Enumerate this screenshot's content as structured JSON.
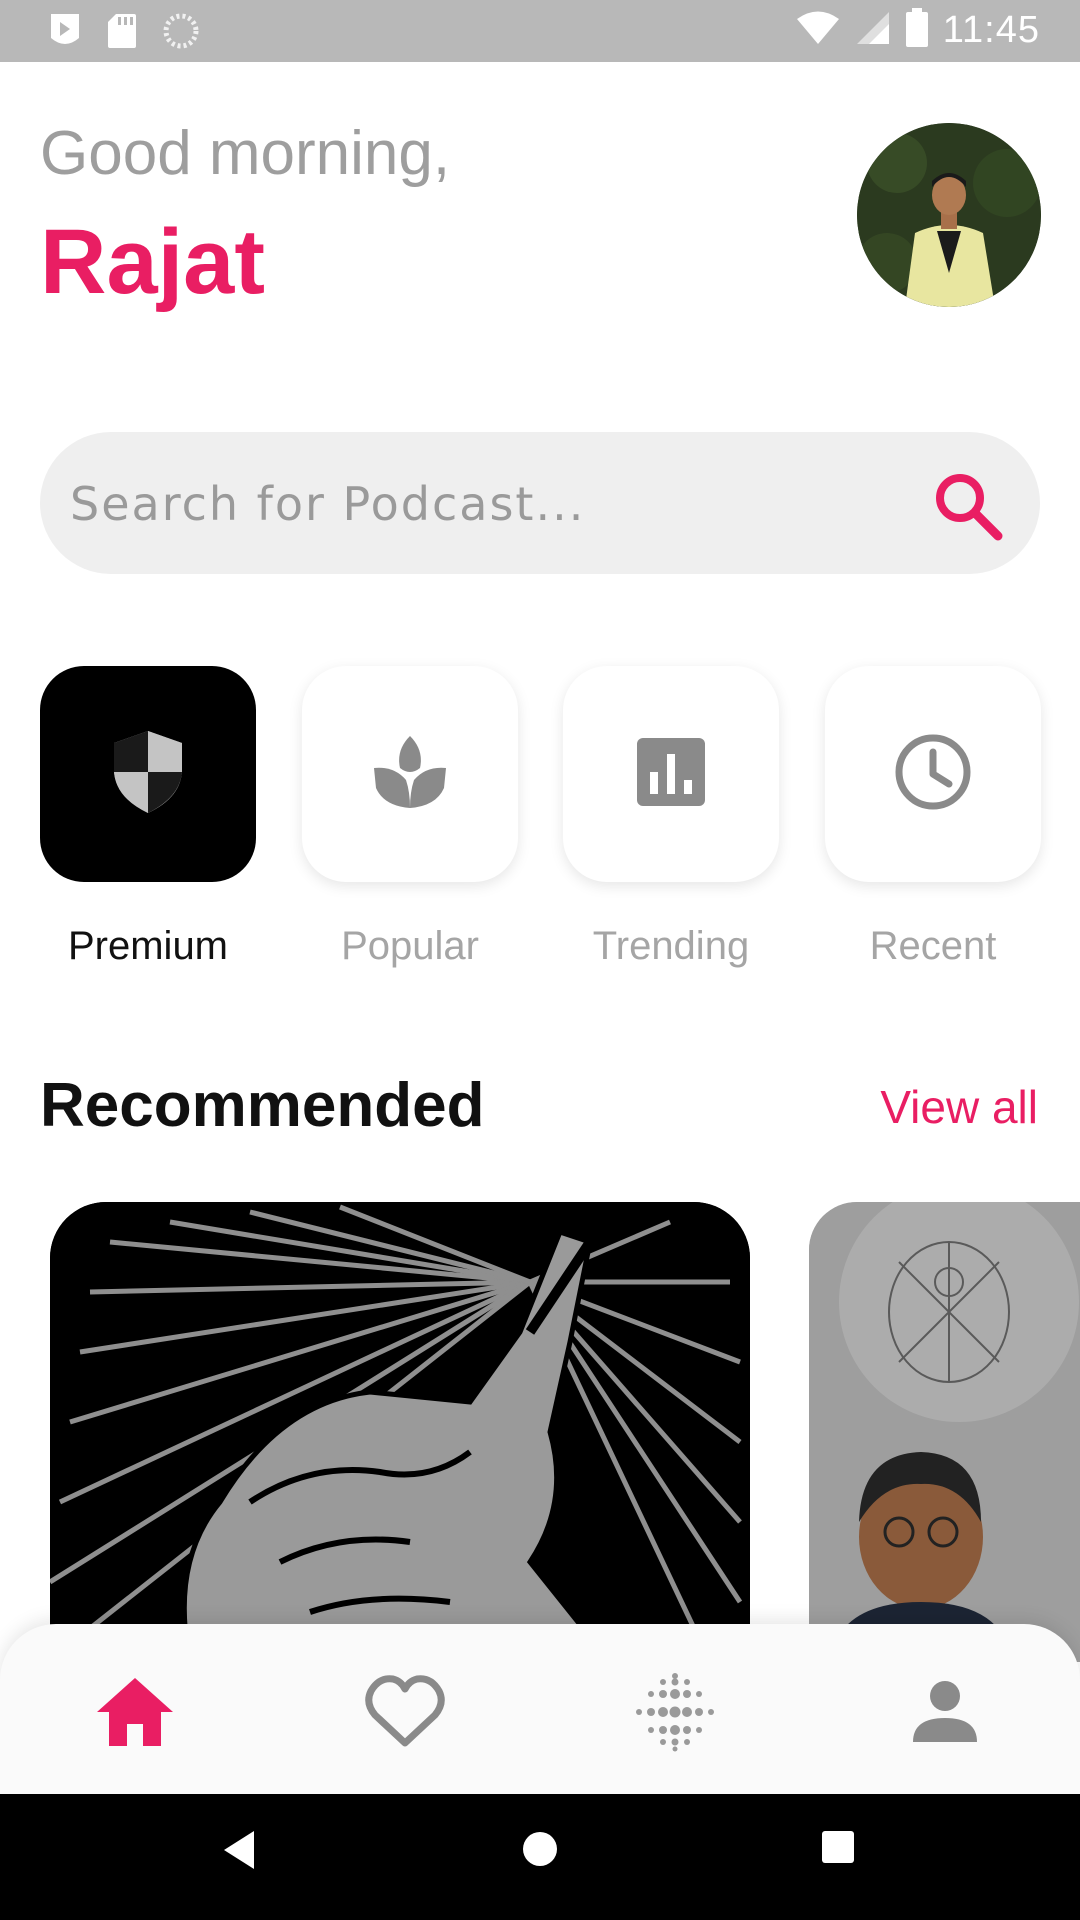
{
  "status_bar": {
    "time": "11:45",
    "icons": [
      "play-store-icon",
      "sd-card-icon",
      "loading-icon",
      "wifi-icon",
      "signal-icon",
      "battery-icon"
    ]
  },
  "header": {
    "greeting": "Good morning,",
    "user_name": "Rajat"
  },
  "search": {
    "placeholder": "Search for Podcast..."
  },
  "categories": [
    {
      "label": "Premium",
      "icon": "shield-icon",
      "active": true
    },
    {
      "label": "Popular",
      "icon": "spa-icon",
      "active": false
    },
    {
      "label": "Trending",
      "icon": "bar-chart-icon",
      "active": false
    },
    {
      "label": "Recent",
      "icon": "clock-icon",
      "active": false
    }
  ],
  "recommended": {
    "title": "Recommended",
    "view_all": "View all"
  },
  "bottom_nav": [
    {
      "icon": "home-icon",
      "active": true
    },
    {
      "icon": "heart-icon",
      "active": false
    },
    {
      "icon": "dots-grid-icon",
      "active": false
    },
    {
      "icon": "person-icon",
      "active": false
    }
  ],
  "colors": {
    "accent": "#e91e63",
    "text_dark": "#111111",
    "text_muted": "#9e9e9e",
    "status_bar": "#b8b8b8"
  }
}
